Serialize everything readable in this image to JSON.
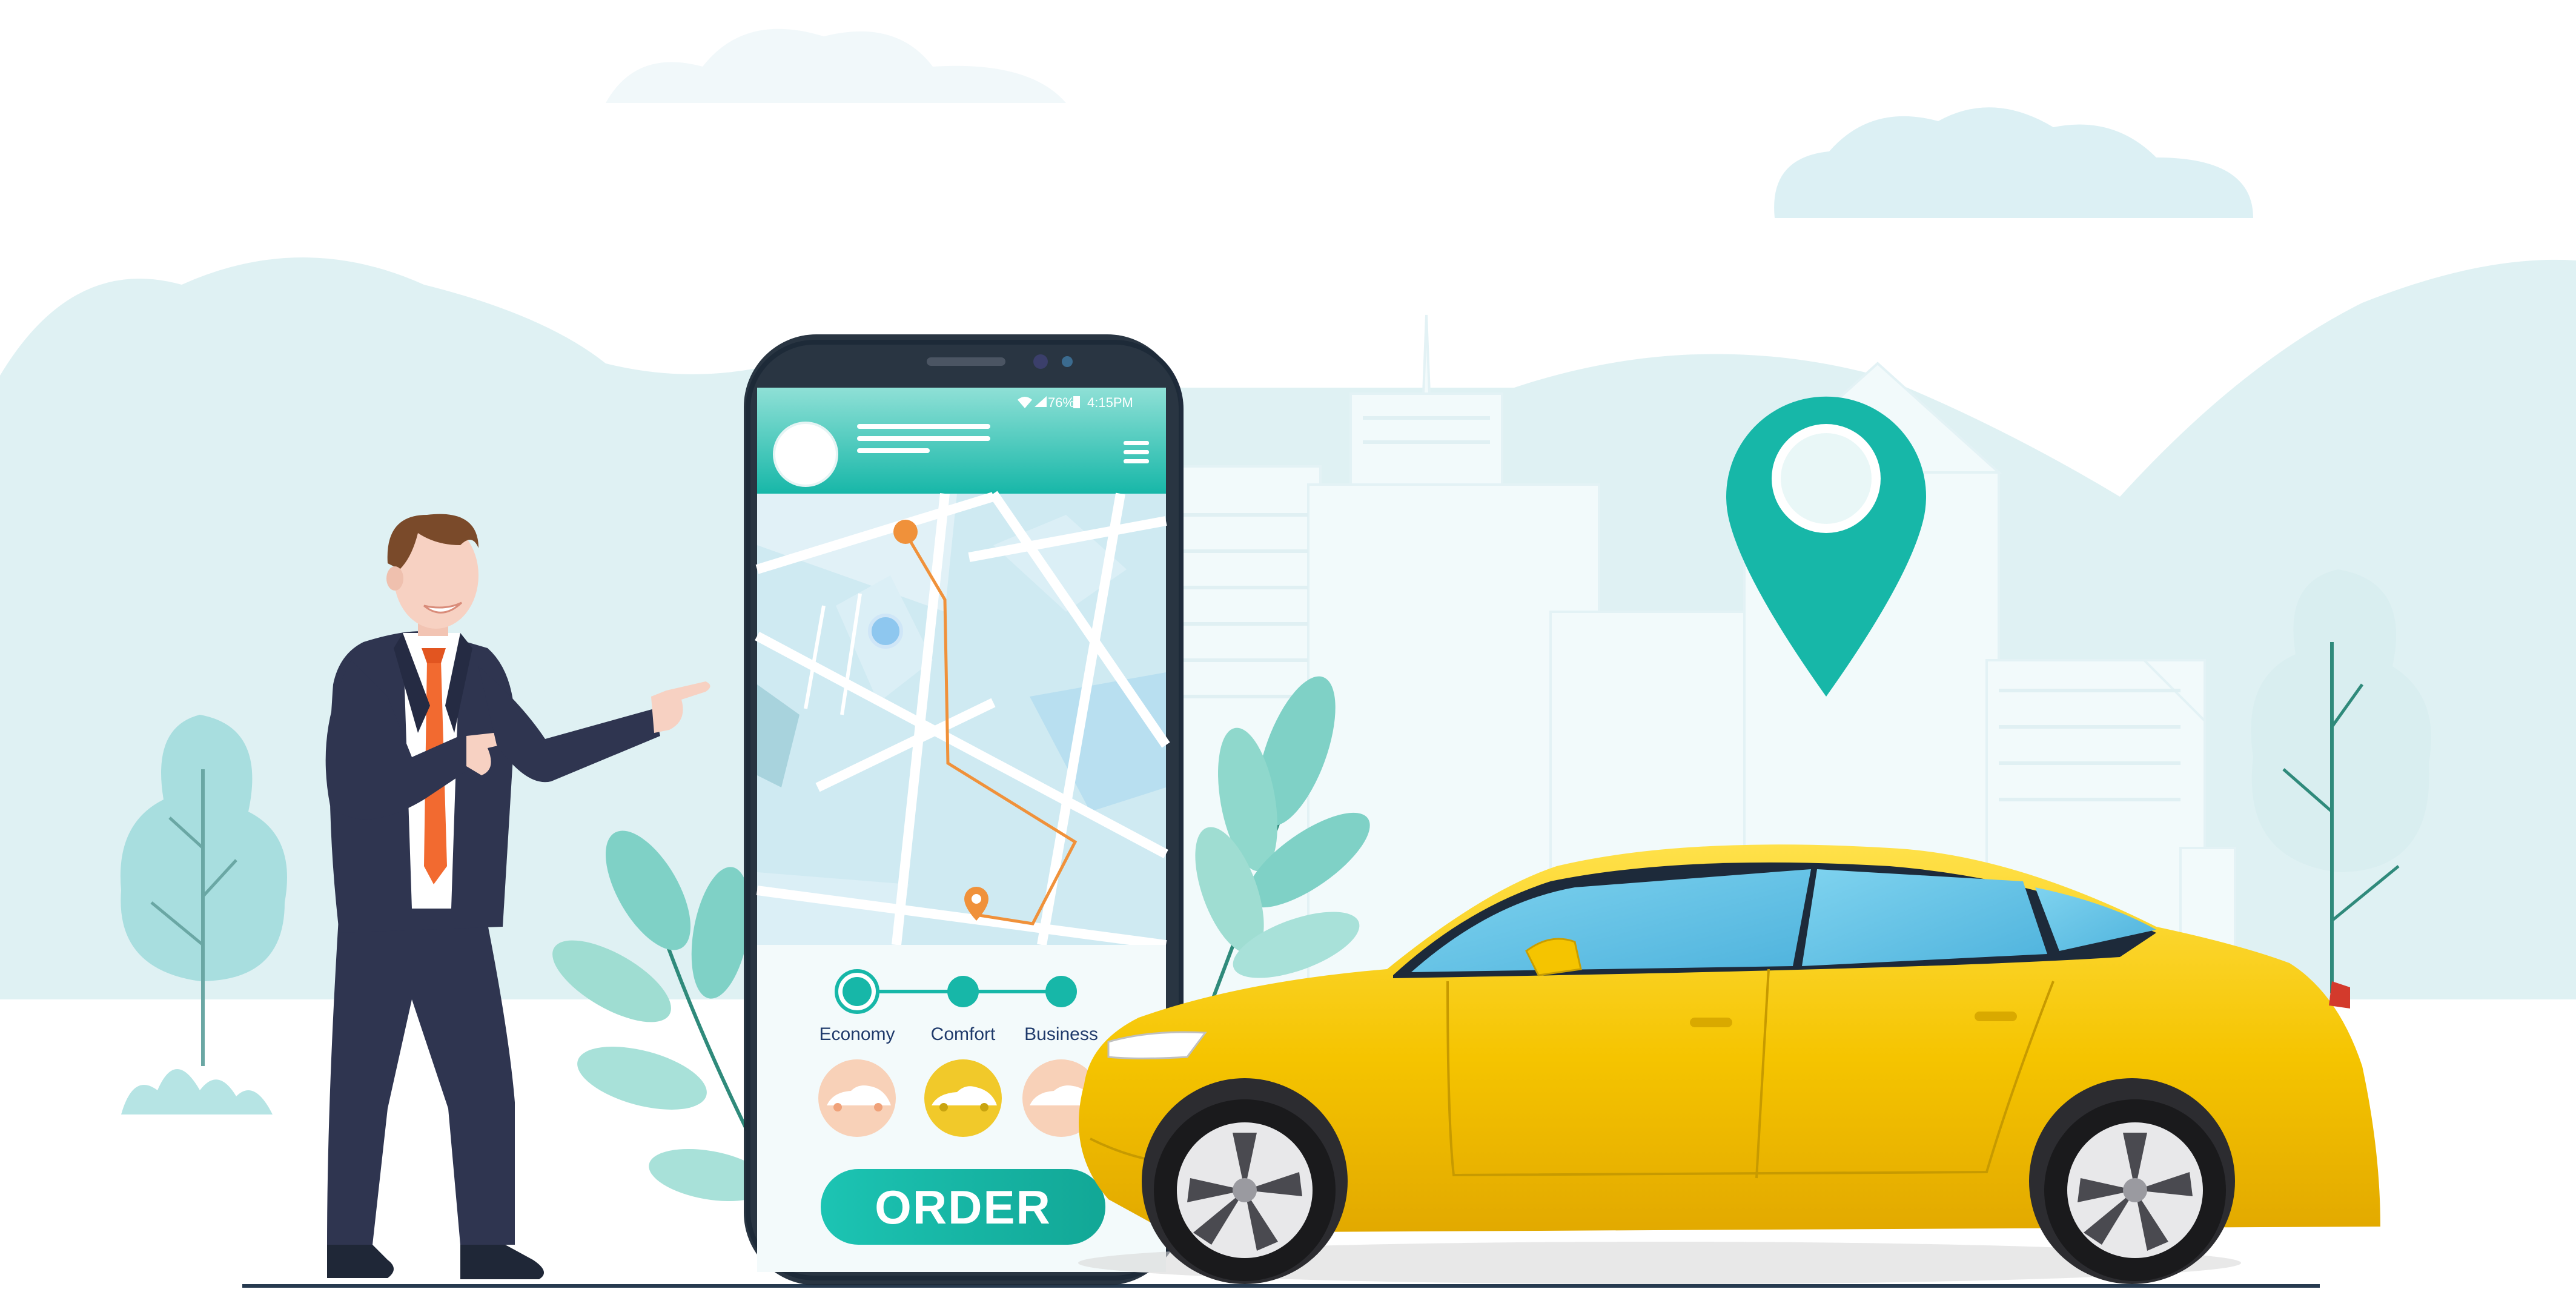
{
  "status_bar": {
    "battery": "76%",
    "time": "4:15PM"
  },
  "car_classes": [
    {
      "label": "Economy",
      "selected": true
    },
    {
      "label": "Comfort",
      "selected": false
    },
    {
      "label": "Business",
      "selected": false
    }
  ],
  "order_button": {
    "label": "ORDER"
  },
  "colors": {
    "teal": "#17b7a8",
    "taxi_yellow": "#f5c400",
    "route_orange": "#f0913a",
    "suit_navy": "#2f3550",
    "background_mint": "#dff1f3"
  },
  "icons": [
    "map-pin-icon",
    "hamburger-menu-icon",
    "wifi-icon",
    "signal-icon",
    "battery-icon",
    "car-icon"
  ]
}
